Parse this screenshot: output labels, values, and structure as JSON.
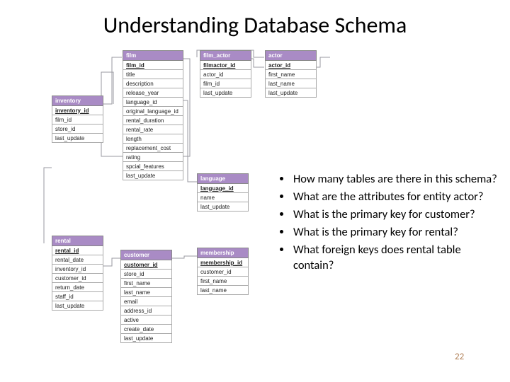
{
  "title": "Understanding Database Schema",
  "page_number": "22",
  "bullets": [
    "How many tables are there in this schema?",
    "What are the attributes for entity actor?",
    "What is the primary key for customer?",
    "What is the primary key for rental?",
    "What foreign keys does rental table contain?"
  ],
  "tables": {
    "inventory": {
      "name": "inventory",
      "pk": "inventory_id",
      "cols": [
        "film_id",
        "store_id",
        "last_update"
      ]
    },
    "rental": {
      "name": "rental",
      "pk": "rental_id",
      "cols": [
        "rental_date",
        "inventory_id",
        "customer_id",
        "return_date",
        "staff_id",
        "last_update"
      ]
    },
    "film": {
      "name": "film",
      "pk": "film_id",
      "cols": [
        "title",
        "description",
        "release_year",
        "language_id",
        "original_language_id",
        "rental_duration",
        "rental_rate",
        "length",
        "replacement_cost",
        "rating",
        "spcial_features",
        "last_update"
      ]
    },
    "customer": {
      "name": "customer",
      "pk": "customer_id",
      "cols": [
        "store_id",
        "first_name",
        "last_name",
        "email",
        "address_id",
        "active",
        "create_date",
        "last_update"
      ]
    },
    "film_actor": {
      "name": "film_actor",
      "pk": "filmactor_id",
      "cols": [
        "actor_id",
        "film_id",
        "last_update"
      ]
    },
    "language": {
      "name": "language",
      "pk": "language_id",
      "cols": [
        "name",
        "last_update"
      ]
    },
    "membership": {
      "name": "membership",
      "pk": "membership_id",
      "cols": [
        "customer_id",
        "first_name",
        "last_name"
      ]
    },
    "actor": {
      "name": "actor",
      "pk": "actor_id",
      "cols": [
        "first_name",
        "last_name",
        "last_update"
      ]
    }
  }
}
